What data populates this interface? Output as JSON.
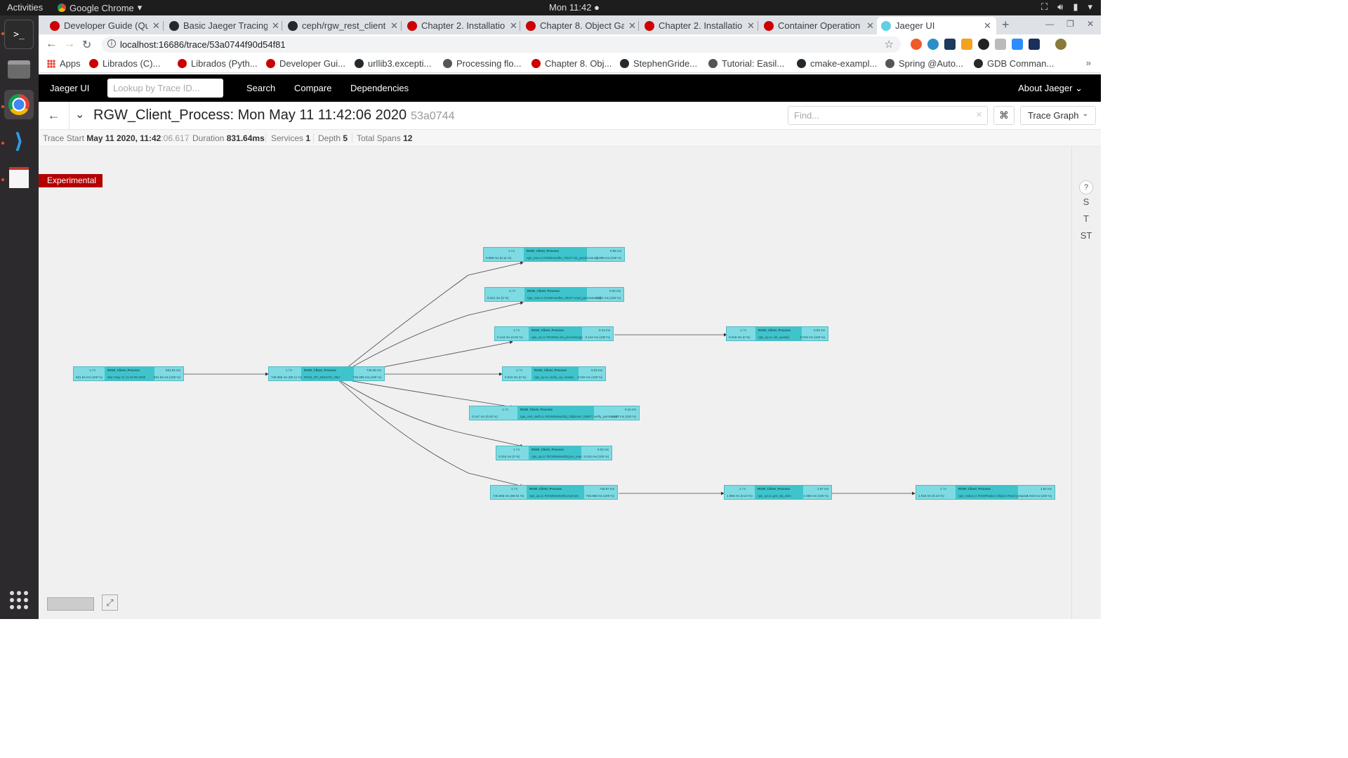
{
  "system": {
    "activities": "Activities",
    "app_name": "Google Chrome",
    "clock": "Mon 11:42"
  },
  "tabs": [
    {
      "label": "Developer Guide (Qu",
      "color": "#cc0000"
    },
    {
      "label": "Basic Jaeger Tracing",
      "color": "#24292e"
    },
    {
      "label": "ceph/rgw_rest_client",
      "color": "#24292e"
    },
    {
      "label": "Chapter 2. Installatio",
      "color": "#cc0000"
    },
    {
      "label": "Chapter 8. Object Ga",
      "color": "#cc0000"
    },
    {
      "label": "Chapter 2. Installatio",
      "color": "#cc0000"
    },
    {
      "label": "Container Operation",
      "color": "#cc0000"
    },
    {
      "label": "Jaeger UI",
      "color": "#60d0e4"
    }
  ],
  "address": {
    "url": "localhost:16686/trace/53a0744f90d54f81"
  },
  "bookmarks": [
    {
      "label": "Apps",
      "color": "#4285f4"
    },
    {
      "label": "Librados (C)...",
      "color": "#cc0000"
    },
    {
      "label": "Librados (Pyth...",
      "color": "#cc0000"
    },
    {
      "label": "Developer Gui...",
      "color": "#cc0000"
    },
    {
      "label": "urllib3.excepti...",
      "color": "#24292e"
    },
    {
      "label": "Processing flo...",
      "color": "#555555"
    },
    {
      "label": "Chapter 8. Obj...",
      "color": "#cc0000"
    },
    {
      "label": "StephenGride...",
      "color": "#24292e"
    },
    {
      "label": "Tutorial: Easil...",
      "color": "#555555"
    },
    {
      "label": "cmake-exampl...",
      "color": "#24292e"
    },
    {
      "label": "Spring @Auto...",
      "color": "#555555"
    },
    {
      "label": "GDB Comman...",
      "color": "#24292e"
    }
  ],
  "jaeger_nav": {
    "brand": "Jaeger UI",
    "lookup_placeholder": "Lookup by Trace ID...",
    "search": "Search",
    "compare": "Compare",
    "dependencies": "Dependencies",
    "about": "About Jaeger"
  },
  "trace": {
    "service": "RGW_Client_Process:",
    "start_text": "Mon May 11 11:42:06 2020",
    "short_id": "53a0744",
    "find_placeholder": "Find...",
    "view_mode": "Trace Graph",
    "trace_start_label": "Trace Start",
    "trace_start_date": "May 11 2020, 11:42",
    "trace_start_ms": ":06.617",
    "duration_label": "Duration",
    "duration": "831.64ms",
    "services_label": "Services",
    "services": "1",
    "depth_label": "Depth",
    "depth": "5",
    "total_spans_label": "Total Spans",
    "total_spans": "12"
  },
  "experimental": "Experimental",
  "side_controls": [
    "?",
    "S",
    "T",
    "ST"
  ],
  "nodes": [
    {
      "count": "1 / 0",
      "service": "RGW_Client_Process",
      "dur": "831.64 ms",
      "op": "Mon May 11 11:42:06 2020",
      "self_pct": "831.64 ms (100 %)",
      "self_r": "831.64 ms (100 %)"
    },
    {
      "count": "1 / 0",
      "service": "RGW_Client_Process",
      "dur": "749.36 ms",
      "op": "RGW_OP_DELETE_OBJ",
      "self_pct": "749.365 ms (90.11 %)",
      "self_r": "749.365 ms (100 %)"
    },
    {
      "count": "1 / 0",
      "service": "RGW_Client_Process",
      "dur": "0.89 ms",
      "op": "rgw_rest.cc RGWHandler_REST init_permissions()",
      "self_pct": "0.889 ms (0.11 %)",
      "self_r": "0.889 ms (100 %)"
    },
    {
      "count": "1 / 0",
      "service": "RGW_Client_Process",
      "dur": "0.02 ms",
      "op": "rgw_rest.cc RGWHandler_REST read_permissions()",
      "self_pct": "0.021 ms (0 %)",
      "self_r": "0.021 ms (100 %)"
    },
    {
      "count": "1 / 0",
      "service": "RGW_Client_Process",
      "dur": "0.14 ms",
      "op": "rgw_op.cc RGWOp init_processing()",
      "self_pct": "0.144 ms (0.02 %)",
      "self_r": "0.144 ms (100 %)"
    },
    {
      "count": "1 / 0",
      "service": "RGW_Client_Process",
      "dur": "0.02 ms",
      "op": "rgw_op.cc init_quota()",
      "self_pct": "0.018 ms (0 %)",
      "self_r": "0.018 ms (100 %)"
    },
    {
      "count": "1 / 0",
      "service": "RGW_Client_Process",
      "dur": "0.03 ms",
      "op": "rgw_op.cc verify_op_mask()",
      "self_pct": "0.034 ms (0 %)",
      "self_r": "0.034 ms (100 %)"
    },
    {
      "count": "1 / 0",
      "service": "RGW_Client_Process",
      "dur": "0.15 ms",
      "op": "rgw_rest_swift.cc RGWDeleteObj_ObjStore_SWIFT verify_permission",
      "self_pct": "0.147 ms (0.02 %)",
      "self_r": "0.147 ms (100 %)"
    },
    {
      "count": "1 / 0",
      "service": "RGW_Client_Process",
      "dur": "0.02 ms",
      "op": "rgw_op.cc RGWDeleteObj pre_exec",
      "self_pct": "0.015 ms (0 %)",
      "self_r": "0.015 ms (100 %)"
    },
    {
      "count": "1 / 0",
      "service": "RGW_Client_Process",
      "dur": "746.87 ms",
      "op": "rgw_op.cc RGWDeleteObj execute",
      "self_pct": "746.866 ms (89.81 %)",
      "self_r": "746.866 ms (100 %)"
    },
    {
      "count": "1 / 0",
      "service": "RGW_Client_Process",
      "dur": "1.97 ms",
      "op": "rgw_op.cc get_obj_attrs",
      "self_pct": "1.966 ms (0.24 %)",
      "self_r": "1.966 ms (100 %)"
    },
    {
      "count": "1 / 0",
      "service": "RGW_Client_Process",
      "dur": "1.92 ms",
      "op": "rgw_rados.cc RGWRados::Object::Read::prepare",
      "self_pct": "1.918 ms (0.23 %)",
      "self_r": "1.918 ms (100 %)"
    }
  ]
}
